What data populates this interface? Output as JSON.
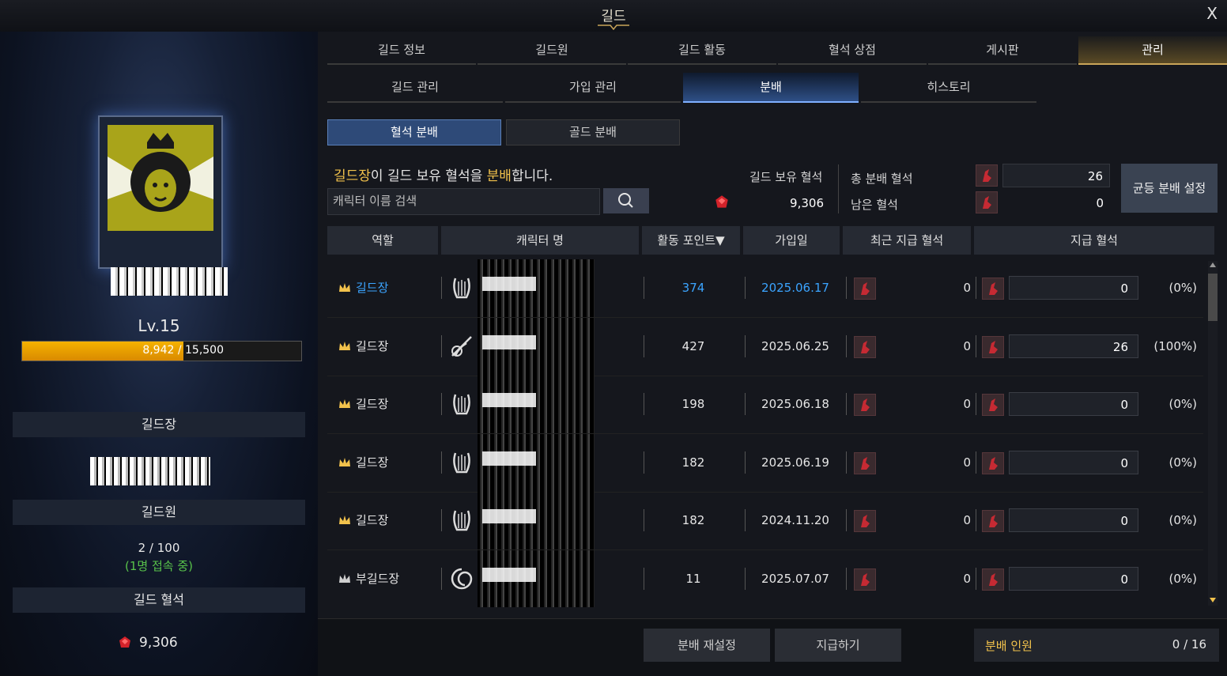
{
  "window": {
    "title": "길드",
    "close_label": "X"
  },
  "left": {
    "level": "Lv.15",
    "xp_text": "8,942 / 15,500",
    "xp_progress": 0.5769,
    "leader_header": "길드장",
    "members_header": "길드원",
    "member_count": "2 / 100",
    "online_text": "(1명 접속 중)",
    "bloodstone_header": "길드 혈석",
    "bloodstone_value": "9,306"
  },
  "tabs": [
    "길드 정보",
    "길드원",
    "길드 활동",
    "혈석 상점",
    "게시판",
    "관리"
  ],
  "subtabs": [
    "길드 관리",
    "가입 관리",
    "분배",
    "히스토리"
  ],
  "mode_buttons": {
    "bloodstone": "혈석 분배",
    "gold": "골드 분배"
  },
  "description": {
    "part1": "길드장",
    "part2": "이 길드 보유 혈석을 ",
    "part3": "분배",
    "part4": "합니다."
  },
  "search": {
    "placeholder": "캐릭터 이름 검색"
  },
  "summary": {
    "owned_label": "길드 보유 혈석",
    "owned_value": "9,306",
    "total_label": "총 분배 혈석",
    "total_value": "26",
    "remaining_label": "남은 혈석",
    "remaining_value": "0",
    "equal_button": "균등 분배 설정"
  },
  "table": {
    "headers": [
      "역할",
      "캐릭터 명",
      "활동 포인트▼",
      "가입일",
      "최근 지급 혈석",
      "지급 혈석"
    ],
    "rows": [
      {
        "role": "길드장",
        "points": "374",
        "joined": "2025.06.17",
        "recent": "0",
        "pay": "0",
        "pct": "(0%)",
        "highlight": true,
        "crown": "gold"
      },
      {
        "role": "길드장",
        "points": "427",
        "joined": "2025.06.25",
        "recent": "0",
        "pay": "26",
        "pct": "(100%)",
        "highlight": false,
        "crown": "gold"
      },
      {
        "role": "길드장",
        "points": "198",
        "joined": "2025.06.18",
        "recent": "0",
        "pay": "0",
        "pct": "(0%)",
        "highlight": false,
        "crown": "gold"
      },
      {
        "role": "길드장",
        "points": "182",
        "joined": "2025.06.19",
        "recent": "0",
        "pay": "0",
        "pct": "(0%)",
        "highlight": false,
        "crown": "gold"
      },
      {
        "role": "길드장",
        "points": "182",
        "joined": "2024.11.20",
        "recent": "0",
        "pay": "0",
        "pct": "(0%)",
        "highlight": false,
        "crown": "gold"
      },
      {
        "role": "부길드장",
        "points": "11",
        "joined": "2025.07.07",
        "recent": "0",
        "pay": "0",
        "pct": "(0%)",
        "highlight": false,
        "crown": "silver"
      }
    ]
  },
  "footer": {
    "reset": "분배 재설정",
    "pay": "지급하기",
    "count_label": "분배 인원",
    "count_value": "0 / 16"
  },
  "colors": {
    "highlight": "#3ba4ff",
    "gold": "#f2c24c",
    "online": "#58c24a",
    "active_tab": "#c9a559"
  }
}
